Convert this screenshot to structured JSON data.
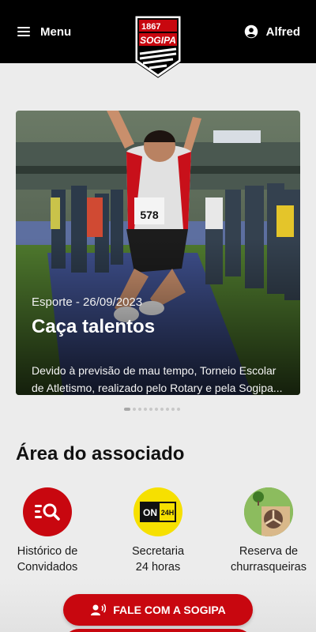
{
  "header": {
    "menu_label": "Menu",
    "user_name": "Alfred",
    "logo_text": "SOGIPA",
    "logo_year": "1867"
  },
  "hero": {
    "meta": "Esporte - 26/09/2023",
    "title": "Caça talentos",
    "description": "Devido à previsão de mau tempo, Torneio Escolar de Atletismo, realizado pelo Rotary e pela Sogipa...",
    "bib_number": "578",
    "slide_count": 10,
    "active_slide": 1
  },
  "member_area": {
    "title": "Área do associado",
    "items": [
      {
        "label": "Histórico de Convidados",
        "icon": "guest-search-icon"
      },
      {
        "label": "Secretaria 24 horas",
        "icon": "on-24h-icon"
      },
      {
        "label": "Reserva de churrasqueiras",
        "icon": "barbecue-icon"
      }
    ]
  },
  "cta": {
    "label": "FALE COM A SOGIPA",
    "icon": "contact-person-icon"
  },
  "colors": {
    "brand_red": "#c8070f",
    "header_bg": "#000000",
    "page_bg": "#ececec",
    "badge_yellow": "#f6e000"
  }
}
